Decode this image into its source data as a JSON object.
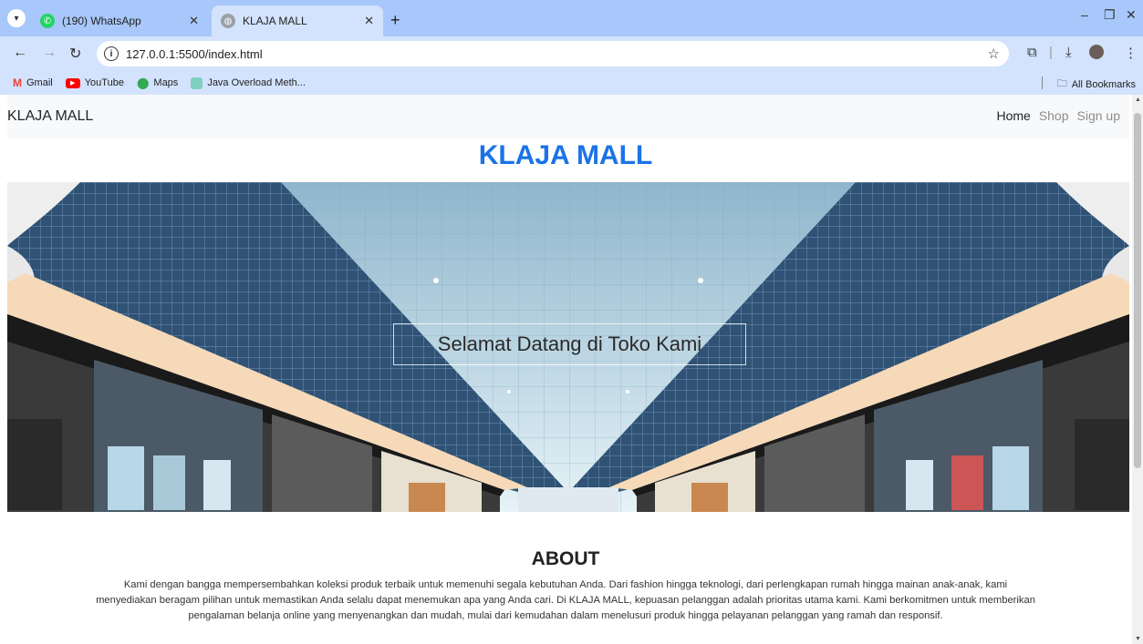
{
  "browser": {
    "tabs": [
      {
        "title": "(190) WhatsApp",
        "active": false,
        "favicon": "whatsapp-icon",
        "favicon_color": "#25d366"
      },
      {
        "title": "KLAJA MALL",
        "active": true,
        "favicon": "globe-icon",
        "favicon_color": "#9aa0a6"
      }
    ],
    "url": "127.0.0.1:5500/index.html",
    "bookmarks": [
      {
        "label": "Gmail",
        "icon": "gmail-icon"
      },
      {
        "label": "YouTube",
        "icon": "youtube-icon"
      },
      {
        "label": "Maps",
        "icon": "maps-icon"
      },
      {
        "label": "Java Overload Meth...",
        "icon": "page-icon"
      }
    ],
    "all_bookmarks": "All Bookmarks"
  },
  "site": {
    "brand": "KLAJA MALL",
    "nav": [
      {
        "label": "Home",
        "active": true
      },
      {
        "label": "Shop",
        "active": false
      },
      {
        "label": "Sign up",
        "active": false
      }
    ],
    "hero_title": "KLAJA MALL",
    "hero_caption": "Selamat Datang di Toko Kami",
    "about_title": "ABOUT",
    "about_text": "Kami dengan bangga mempersembahkan koleksi produk terbaik untuk memenuhi segala kebutuhan Anda. Dari fashion hingga teknologi, dari perlengkapan rumah hingga mainan anak-anak, kami menyediakan beragam pilihan untuk memastikan Anda selalu dapat menemukan apa yang Anda cari. Di KLAJA MALL, kepuasan pelanggan adalah prioritas utama kami. Kami berkomitmen untuk memberikan pengalaman belanja online yang menyenangkan dan mudah, mulai dari kemudahan dalam menelusuri produk hingga pelayanan pelanggan yang ramah dan responsif."
  },
  "colors": {
    "accent": "#1a73e8",
    "tabstrip": "#a8c7fa",
    "toolbar": "#d3e3fd"
  }
}
